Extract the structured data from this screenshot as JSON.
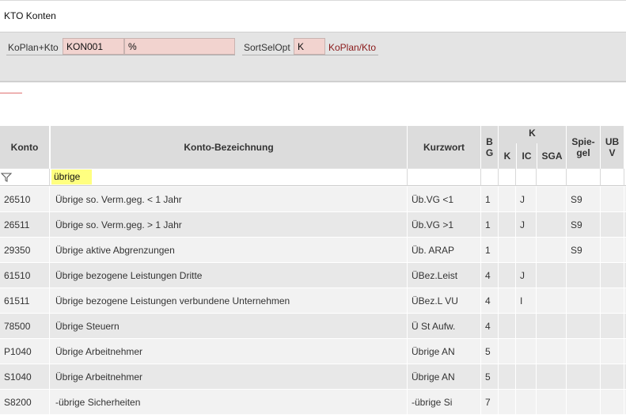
{
  "window": {
    "title": "KTO Konten"
  },
  "filter_panel": {
    "koplan_label": "KoPlan+Kto",
    "koplan_value": "KON001",
    "kto_value": "%",
    "sortsel_label": "SortSelOpt",
    "sortsel_value": "K",
    "sortsel_text": "KoPlan/Kto"
  },
  "table": {
    "headers": {
      "konto": "Konto",
      "bezeichnung": "Konto-Bezeichnung",
      "kurzwort": "Kurzwort",
      "bg": "B G",
      "k_group": "K",
      "k": "K",
      "ic": "IC",
      "sga": "SGA",
      "spiegel": "Spie- gel",
      "ubv": "UB V"
    },
    "filter_value": "übrige",
    "rows": [
      {
        "konto": "26510",
        "bezeichnung": "Übrige so. Verm.geg. < 1 Jahr",
        "kurzwort": "Üb.VG <1",
        "bg": "1",
        "k": "",
        "ic": "J",
        "sga": "",
        "spiegel": "S9",
        "ubv": ""
      },
      {
        "konto": "26511",
        "bezeichnung": "Übrige so. Verm.geg. > 1 Jahr",
        "kurzwort": "Üb.VG >1",
        "bg": "1",
        "k": "",
        "ic": "J",
        "sga": "",
        "spiegel": "S9",
        "ubv": ""
      },
      {
        "konto": "29350",
        "bezeichnung": "Übrige aktive Abgrenzungen",
        "kurzwort": "Üb. ARAP",
        "bg": "1",
        "k": "",
        "ic": "",
        "sga": "",
        "spiegel": "S9",
        "ubv": ""
      },
      {
        "konto": "61510",
        "bezeichnung": "Übrige bezogene Leistungen Dritte",
        "kurzwort": "ÜBez.Leist",
        "bg": "4",
        "k": "",
        "ic": "J",
        "sga": "",
        "spiegel": "",
        "ubv": ""
      },
      {
        "konto": "61511",
        "bezeichnung": "Übrige bezogene Leistungen verbundene Unternehmen",
        "kurzwort": "ÜBez.L VU",
        "bg": "4",
        "k": "",
        "ic": "I",
        "sga": "",
        "spiegel": "",
        "ubv": ""
      },
      {
        "konto": "78500",
        "bezeichnung": "Übrige Steuern",
        "kurzwort": "Ü St Aufw.",
        "bg": "4",
        "k": "",
        "ic": "",
        "sga": "",
        "spiegel": "",
        "ubv": ""
      },
      {
        "konto": "P1040",
        "bezeichnung": "Übrige Arbeitnehmer",
        "kurzwort": "Übrige AN",
        "bg": "5",
        "k": "",
        "ic": "",
        "sga": "",
        "spiegel": "",
        "ubv": ""
      },
      {
        "konto": "S1040",
        "bezeichnung": "Übrige Arbeitnehmer",
        "kurzwort": "Übrige AN",
        "bg": "5",
        "k": "",
        "ic": "",
        "sga": "",
        "spiegel": "",
        "ubv": ""
      },
      {
        "konto": "S8200",
        "bezeichnung": "-übrige Sicherheiten",
        "kurzwort": "-übrige Si",
        "bg": "7",
        "k": "",
        "ic": "",
        "sga": "",
        "spiegel": "",
        "ubv": ""
      }
    ]
  }
}
